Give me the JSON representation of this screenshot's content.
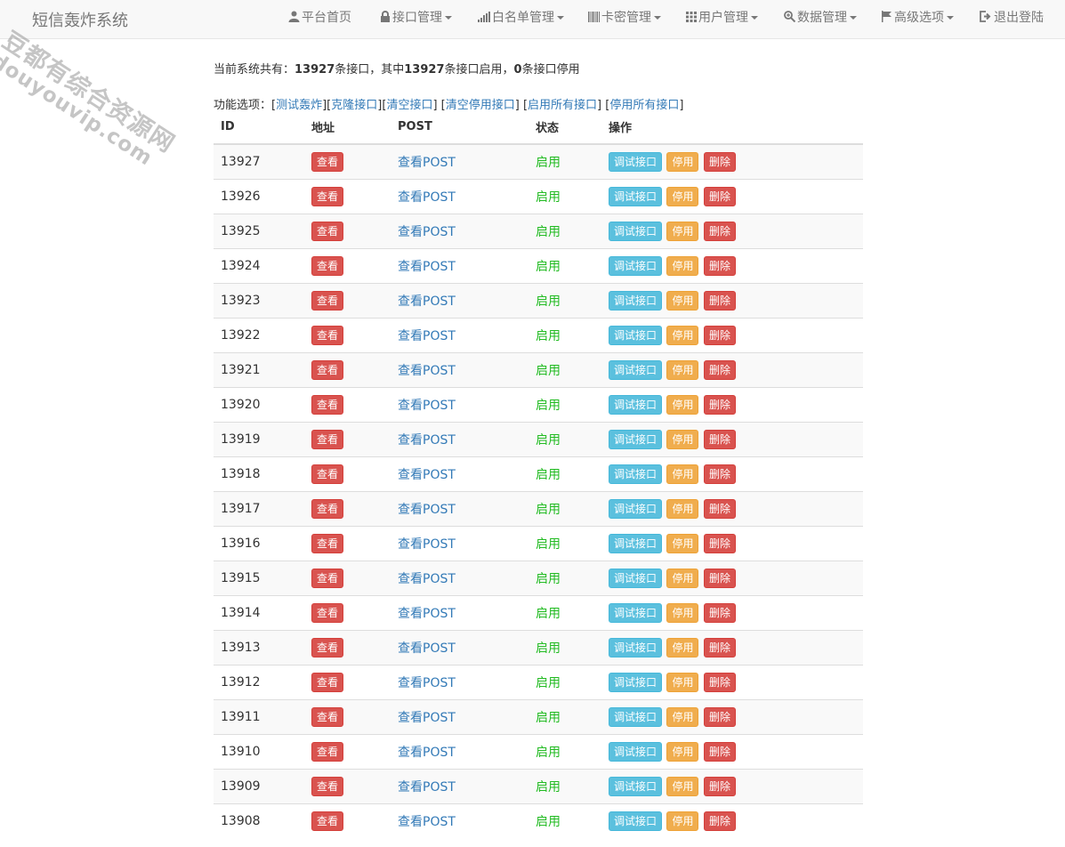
{
  "app": {
    "brand": "短信轰炸系统"
  },
  "nav": [
    {
      "label": "平台首页",
      "icon": "user-icon",
      "dropdown": false
    },
    {
      "label": "接口管理",
      "icon": "lock-icon",
      "dropdown": true
    },
    {
      "label": "白名单管理",
      "icon": "signal-icon",
      "dropdown": true
    },
    {
      "label": "卡密管理",
      "icon": "barcode-icon",
      "dropdown": true
    },
    {
      "label": "用户管理",
      "icon": "grid-icon",
      "dropdown": true
    },
    {
      "label": "数据管理",
      "icon": "zoom-icon",
      "dropdown": true
    },
    {
      "label": "高级选项",
      "icon": "flag-icon",
      "dropdown": true
    },
    {
      "label": "退出登陆",
      "icon": "logout-icon",
      "dropdown": false
    }
  ],
  "watermark": {
    "line1": "豆都有综合资源网",
    "line2": "douyouvip.com"
  },
  "summary": {
    "prefix": "当前系统共有：",
    "total": "13927",
    "mid1": "条接口，其中",
    "enabled": "13927",
    "mid2": "条接口启用，",
    "disabled": "0",
    "suffix": "条接口停用"
  },
  "functions": {
    "label": "功能选项：",
    "links": [
      "测试轰炸",
      "克隆接口",
      "清空接口",
      "清空停用接口",
      "启用所有接口",
      "停用所有接口"
    ]
  },
  "table": {
    "headers": {
      "id": "ID",
      "address": "地址",
      "post": "POST",
      "status": "状态",
      "action": "操作"
    },
    "view_label": "查看",
    "post_label": "查看POST",
    "status_label": "启用",
    "debug_label": "调试接口",
    "disable_label": "停用",
    "delete_label": "删除",
    "rows": [
      "13927",
      "13926",
      "13925",
      "13924",
      "13923",
      "13922",
      "13921",
      "13920",
      "13919",
      "13918",
      "13917",
      "13916",
      "13915",
      "13914",
      "13913",
      "13912",
      "13911",
      "13910",
      "13909",
      "13908"
    ]
  },
  "colors": {
    "danger": "#d9534f",
    "info": "#5bc0de",
    "warning": "#f0ad4e",
    "link": "#337ab7",
    "status": "#22bb22"
  }
}
